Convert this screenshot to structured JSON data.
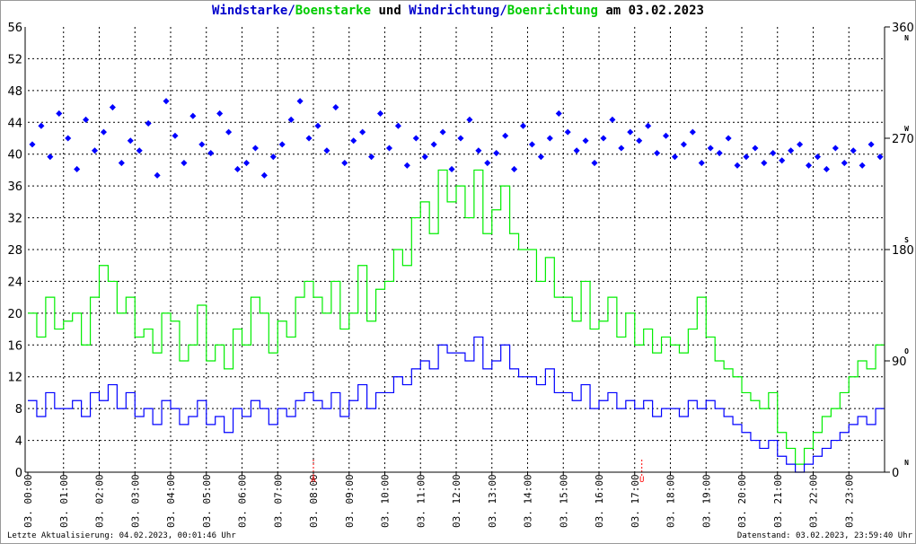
{
  "title": {
    "part1": "Windstarke",
    "sep1": "/",
    "part2": "Boenstarke",
    "mid": " und ",
    "part3": "Windrichtung",
    "sep2": "/",
    "part4": "Boenrichtung",
    "end": " am 03.02.2023"
  },
  "footer": {
    "left": "Letzte Aktualisierung: 04.02.2023, 00:01:46 Uhr",
    "right": "Datenstand: 03.02.2023, 23:59:40 Uhr"
  },
  "chart_data": {
    "type": "line",
    "title": "Windstarke/Boenstarke und Windrichtung/Boenrichtung am 03.02.2023",
    "colors": {
      "wind": "#0000ff",
      "gust": "#00ee00",
      "direction": "#0000ff",
      "gust_direction": "#00ee00",
      "sun_marker": "#ff0000"
    },
    "grid": true,
    "left_axis": {
      "range": [
        0,
        56
      ],
      "ticks": [
        0,
        4,
        8,
        12,
        16,
        20,
        24,
        28,
        32,
        36,
        40,
        44,
        48,
        52,
        56
      ]
    },
    "right_axis": {
      "range": [
        0,
        360
      ],
      "ticks": [
        0,
        90,
        180,
        270,
        360
      ],
      "compass": [
        "N",
        "O",
        "S",
        "W",
        "N"
      ]
    },
    "x_ticks": [
      "03. 00:00",
      "03. 01:00",
      "03. 02:00",
      "03. 03:00",
      "03. 04:00",
      "03. 05:00",
      "03. 06:00",
      "03. 07:00",
      "03. 08:00",
      "03. 09:00",
      "03. 10:00",
      "03. 11:00",
      "03. 12:00",
      "03. 13:00",
      "03. 14:00",
      "03. 15:00",
      "03. 16:00",
      "03. 17:00",
      "03. 18:00",
      "03. 19:00",
      "03. 20:00",
      "03. 21:00",
      "03. 22:00",
      "03. 23:00"
    ],
    "sun_markers": [
      {
        "label": "A",
        "time_h": 8.0
      },
      {
        "label": "U",
        "time_h": 17.2
      }
    ],
    "x_step_minutes": 15,
    "series": [
      {
        "key": "wind",
        "values": [
          9,
          7,
          10,
          8,
          8,
          9,
          7,
          10,
          9,
          11,
          8,
          10,
          7,
          8,
          6,
          9,
          8,
          6,
          7,
          9,
          6,
          7,
          5,
          8,
          7,
          9,
          8,
          6,
          8,
          7,
          9,
          10,
          9,
          8,
          10,
          7,
          9,
          11,
          8,
          10,
          10,
          12,
          11,
          13,
          14,
          13,
          16,
          15,
          15,
          14,
          17,
          13,
          14,
          16,
          13,
          12,
          12,
          11,
          13,
          10,
          10,
          9,
          11,
          8,
          9,
          10,
          8,
          9,
          8,
          9,
          7,
          8,
          8,
          7,
          9,
          8,
          9,
          8,
          7,
          6,
          5,
          4,
          3,
          4,
          2,
          1,
          0,
          1,
          2,
          3,
          4,
          5,
          6,
          7,
          6,
          8
        ]
      },
      {
        "key": "gust",
        "values": [
          20,
          17,
          22,
          18,
          19,
          20,
          16,
          22,
          26,
          24,
          20,
          22,
          17,
          18,
          15,
          20,
          19,
          14,
          16,
          21,
          14,
          16,
          13,
          18,
          16,
          22,
          20,
          15,
          19,
          17,
          22,
          24,
          22,
          20,
          24,
          18,
          20,
          26,
          19,
          23,
          24,
          28,
          26,
          32,
          34,
          30,
          38,
          34,
          36,
          32,
          38,
          30,
          33,
          36,
          30,
          28,
          28,
          24,
          27,
          22,
          22,
          19,
          24,
          18,
          19,
          22,
          17,
          20,
          16,
          18,
          15,
          17,
          16,
          15,
          18,
          22,
          17,
          14,
          13,
          12,
          10,
          9,
          8,
          10,
          5,
          3,
          1,
          3,
          5,
          7,
          8,
          10,
          12,
          14,
          13,
          16
        ]
      },
      {
        "key": "direction",
        "unit": "deg",
        "values": [
          265,
          280,
          255,
          290,
          270,
          245,
          285,
          260,
          275,
          295,
          250,
          268,
          260,
          282,
          240,
          300,
          272,
          250,
          288,
          265,
          258,
          290,
          275,
          245,
          250,
          262,
          240,
          255,
          265,
          285,
          300,
          270,
          280,
          260,
          295,
          250,
          268,
          275,
          255,
          290,
          262,
          280,
          248,
          270,
          255,
          265,
          275,
          245,
          270,
          285,
          260,
          250,
          258,
          272,
          245,
          280,
          265,
          255,
          270,
          290,
          275,
          260,
          268,
          250,
          270,
          285,
          262,
          275,
          268,
          280,
          258,
          272,
          255,
          265,
          275,
          250,
          262,
          258,
          270,
          248,
          255,
          262,
          250,
          258,
          252,
          260,
          265,
          248,
          255,
          245,
          262,
          250,
          260,
          248,
          265,
          255
        ]
      }
    ]
  }
}
